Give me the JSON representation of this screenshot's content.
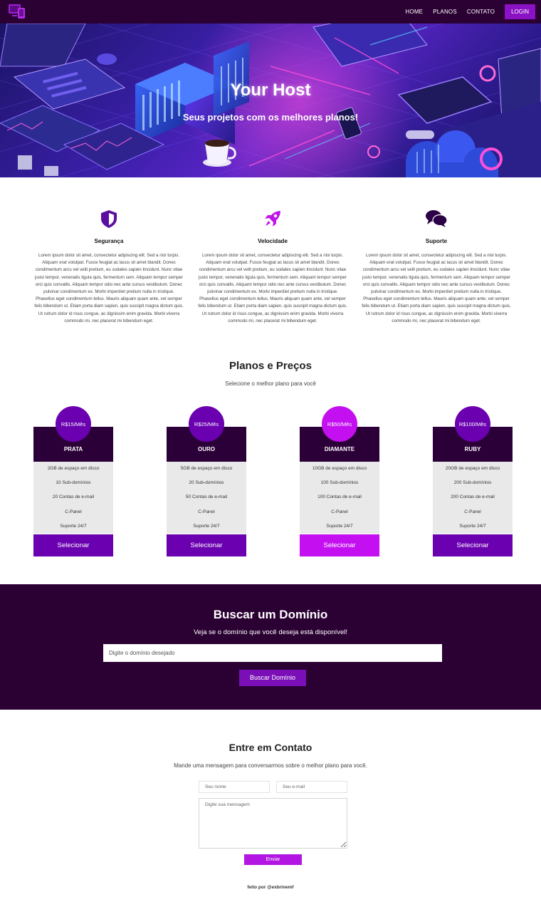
{
  "nav": {
    "logo_icon": "devices-icon",
    "links": [
      "HOME",
      "PLANOS",
      "CONTATO"
    ],
    "login_label": "LOGIN"
  },
  "hero": {
    "title": "Your Host",
    "subtitle": "Seus projetos com os melhores planos!"
  },
  "features": [
    {
      "icon": "shield-icon",
      "title": "Segurança",
      "text": "Lorem ipsum dolor sit amet, consectetur adipiscing elit. Sed a nisl turpis. Aliquam erat volutpat. Fusce feugiat ac lacus sit amet blandit. Donec condimentum arcu vel velit pretium, eu sodales sapien tincidunt. Nunc vitae justo tempor, venenatis ligula quis, fermentum sem. Aliquam tempor semper orci quis convallis. Aliquam tempor odio nec ante cursus vestibulum. Donec pulvinar condimentum ex. Morbi imperdiet pretium nulla in tristique. Phasellus eget condimentum tellus. Mauris aliquam quam ante, vel semper felis bibendum ut. Etiam porta diam sapien, quis suscipit magna dictum quis. Ut rutrum dolor id risus congue, ac dignissim enim gravida. Morbi viverra commodo mi, nec placerat mi bibendum eget."
    },
    {
      "icon": "rocket-icon",
      "title": "Velocidade",
      "text": "Lorem ipsum dolor sit amet, consectetur adipiscing elit. Sed a nisl turpis. Aliquam erat volutpat. Fusce feugiat ac lacus sit amet blandit. Donec condimentum arcu vel velit pretium, eu sodales sapien tincidunt. Nunc vitae justo tempor, venenatis ligula quis, fermentum sem. Aliquam tempor semper orci quis convallis. Aliquam tempor odio nec ante cursus vestibulum. Donec pulvinar condimentum ex. Morbi imperdiet pretium nulla in tristique. Phasellus eget condimentum tellus. Mauris aliquam quam ante, vel semper felis bibendum ut. Etiam porta diam sapien, quis suscipit magna dictum quis. Ut rutrum dolor id risus congue, ac dignissim enim gravida. Morbi viverra commodo mi, nec placerat mi bibendum eget."
    },
    {
      "icon": "chat-icon",
      "title": "Suporte",
      "text": "Lorem ipsum dolor sit amet, consectetur adipiscing elit. Sed a nisl turpis. Aliquam erat volutpat. Fusce feugiat ac lacus sit amet blandit. Donec condimentum arcu vel velit pretium, eu sodales sapien tincidunt. Nunc vitae justo tempor, venenatis ligula quis, fermentum sem. Aliquam tempor semper orci quis convallis. Aliquam tempor odio nec ante cursus vestibulum. Donec pulvinar condimentum ex. Morbi imperdiet pretium nulla in tristique. Phasellus eget condimentum tellus. Mauris aliquam quam ante, vel semper felis bibendum ut. Etiam porta diam sapien, quis suscipit magna dictum quis. Ut rutrum dolor id risus congue, ac dignissim enim gravida. Morbi viverra commodo mi, nec placerat mi bibendum eget."
    }
  ],
  "plans_section": {
    "title": "Planos e Preços",
    "subtitle": "Selecione o melhor plano para você"
  },
  "plans": [
    {
      "price": "R$15/Mês",
      "name": "PRATA",
      "features": [
        "2GB de espaço em disco",
        "10 Sub-domínios",
        "20 Contas de e-mail",
        "C-Panel",
        "Suporte 24/7"
      ],
      "button": "Selecionar",
      "color": "#6a00b0"
    },
    {
      "price": "R$25/Mês",
      "name": "OURO",
      "features": [
        "5GB de espaço em disco",
        "20 Sub-domínios",
        "50 Contas de e-mail",
        "C-Panel",
        "Suporte 24/7"
      ],
      "button": "Selecionar",
      "color": "#6a00b0"
    },
    {
      "price": "R$50/Mês",
      "name": "DIAMANTE",
      "features": [
        "10GB de espaço em disco",
        "100 Sub-domínios",
        "100 Contas de e-mail",
        "C-Panel",
        "Suporte 24/7"
      ],
      "button": "Selecionar",
      "color": "#c410f0"
    },
    {
      "price": "R$100/Mês",
      "name": "RUBY",
      "features": [
        "20GB de espaço em disco",
        "200 Sub-domínios",
        "200 Contas de e-mail",
        "C-Panel",
        "Suporte 24/7"
      ],
      "button": "Selecionar",
      "color": "#6a00b0"
    }
  ],
  "domain": {
    "title": "Buscar um Domínio",
    "subtitle": "Veja se o domínio que você deseja está disponível!",
    "input_placeholder": "Digite o domínio desejado",
    "button": "Buscar Domínio"
  },
  "contact": {
    "title": "Entre em Contato",
    "subtitle": "Mande uma mensagem para conversarmos sobre o melhor plano para você.",
    "name_placeholder": "Seu nome",
    "email_placeholder": "Seu e-mail",
    "message_placeholder": "Digite sua mensagem",
    "button": "Enviar"
  },
  "footer": {
    "text": "feito por @exbrinemf"
  },
  "colors": {
    "nav_bg": "#2b0033",
    "accent": "#8a12c4",
    "highlight": "#c410f0"
  }
}
